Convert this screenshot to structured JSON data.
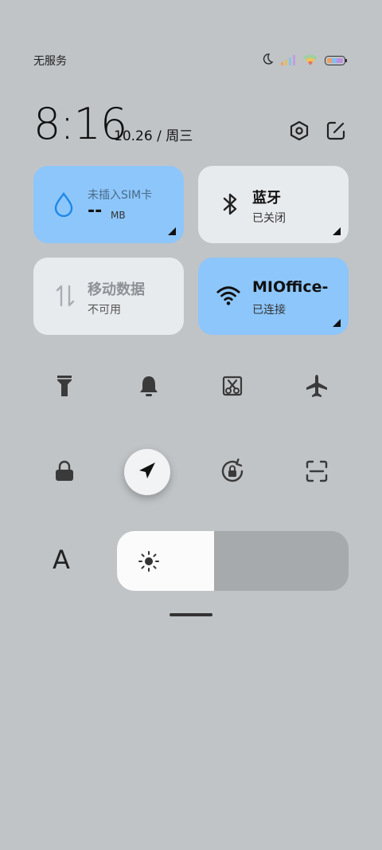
{
  "status_bar": {
    "carrier": "无服务"
  },
  "header": {
    "time": "8:16",
    "date": "10.26 / 周三"
  },
  "tiles": {
    "sim": {
      "title": "未插入SIM卡",
      "value": "--",
      "unit": "MB"
    },
    "bluetooth": {
      "title": "蓝牙",
      "status": "已关闭"
    },
    "mobile_data": {
      "title": "移动数据",
      "status": "不可用"
    },
    "wifi": {
      "title": "MIOffice-",
      "status": "已连接"
    }
  },
  "toggles": [
    "flashlight-icon",
    "bell-icon",
    "screenshot-icon",
    "airplane-icon",
    "lock-icon",
    "location-icon",
    "rotation-lock-icon",
    "scan-icon"
  ],
  "font_size_label": "A",
  "brightness": {
    "level": 0.42
  },
  "colors": {
    "background": "#c0c4c7",
    "accent_tile": "#8dc6fb",
    "tile": "#e8ebee"
  }
}
